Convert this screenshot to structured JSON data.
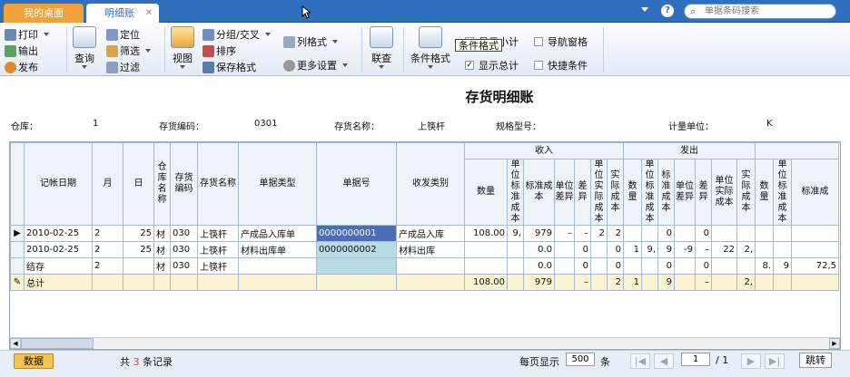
{
  "tabs": [
    {
      "label": "我的桌面"
    },
    {
      "label": "明细账"
    }
  ],
  "search": {
    "placeholder": "单据条码搜索"
  },
  "help": "?",
  "ribbon": {
    "print": "打印",
    "export": "输出",
    "publish": "发布",
    "query": "查询",
    "locate": "定位",
    "filter1": "筛选",
    "filter2": "过滤",
    "view": "视图",
    "group": "分组/交叉",
    "sort": "排序",
    "save_format": "保存格式",
    "column_format": "列格式",
    "more_settings": "更多设置",
    "linked_query": "联查",
    "condition_format": "条件格式",
    "show_subtotal": "显示小计",
    "show_total": "显示总计",
    "nav_pane": "导航窗格",
    "quick_cond": "快捷条件"
  },
  "tooltip": "条件格式",
  "doc": {
    "title": "存货明细账"
  },
  "header": {
    "warehouse_label": "仓库：",
    "warehouse_value": "1",
    "code_label": "存货编码：",
    "code_value": "0301",
    "name_label": "存货名称：",
    "name_value": "上筷杆",
    "spec_label": "规格型号：",
    "unit_label": "计量单位：",
    "unit_value": "K"
  },
  "columns": {
    "date": "记帐日期",
    "month": "月",
    "day": "日",
    "wh": "仓库名称",
    "code": "存货编码",
    "name": "存货名称",
    "doc_type": "单据类型",
    "doc_no": "单据号",
    "category": "收发类别",
    "in_group": "收入",
    "out_group": "发出",
    "qty": "数量",
    "unit_std": "单位标准成本",
    "std": "标准成本",
    "unit_diff": "单位差异",
    "diff": "差异",
    "unit_actual": "单位实际成本",
    "actual": "实际成本",
    "std_partial": "标准成"
  },
  "rows": [
    {
      "date": "2010-02-25",
      "m": "2",
      "d": "25",
      "wh": "材",
      "code": "030",
      "name": "上筷杆",
      "type": "产成品入库单",
      "no": "0000000001",
      "cat": "产成品入库",
      "in": [
        "108.00",
        "9,",
        "979",
        "–",
        "–",
        "2",
        "2"
      ],
      "out": [
        "",
        "",
        "0",
        "",
        "0",
        "",
        ""
      ],
      "out_actual": "0.",
      "tail": [
        "",
        "",
        ""
      ]
    },
    {
      "date": "2010-02-25",
      "m": "2",
      "d": "25",
      "wh": "材",
      "code": "030",
      "name": "上筷杆",
      "type": "材料出库单",
      "no": "0000000002",
      "cat": "材料出库",
      "in": [
        "",
        "",
        "0.0",
        "",
        "0",
        "",
        "0"
      ],
      "out": [
        "1",
        "9,",
        "9",
        "-9",
        "–",
        "22",
        "2,"
      ],
      "out_actual": "",
      "tail": [
        "",
        "",
        ""
      ]
    },
    {
      "date": "结存",
      "m": "2",
      "d": "",
      "wh": "材",
      "code": "030",
      "name": "上筷杆",
      "type": "",
      "no": "",
      "cat": "",
      "in": [
        "",
        "",
        "0.0",
        "",
        "0",
        "",
        "0"
      ],
      "out": [
        "",
        "",
        "0",
        "",
        "0",
        "",
        ""
      ],
      "out_actual": "0.",
      "tail": [
        "8.",
        "9",
        "72,5"
      ]
    },
    {
      "date": "总计",
      "m": "",
      "d": "",
      "wh": "",
      "code": "",
      "name": "",
      "type": "",
      "no": "",
      "cat": "",
      "in": [
        "108.00",
        "",
        "979",
        "",
        "–",
        "",
        "2"
      ],
      "out": [
        "1",
        "",
        "9",
        "",
        "–",
        "",
        "2,"
      ],
      "out_actual": "",
      "tail": [
        "",
        "",
        ""
      ]
    }
  ],
  "footer": {
    "data_btn": "数据",
    "rec_prefix": "共",
    "rec_count": "3",
    "rec_suffix": "条记录",
    "per_page_label": "每页显示",
    "per_page_value": "500",
    "per_page_unit": "条",
    "page_value": "1",
    "page_total": "/ 1",
    "jump": "跳转"
  },
  "colors": {
    "titlebar": "#2f6fbd",
    "desktop_tab": "#f0a23a",
    "selected_cell": "#4a6fb5",
    "total_row": "#faf3cf",
    "data_btn": "#f4c453"
  }
}
